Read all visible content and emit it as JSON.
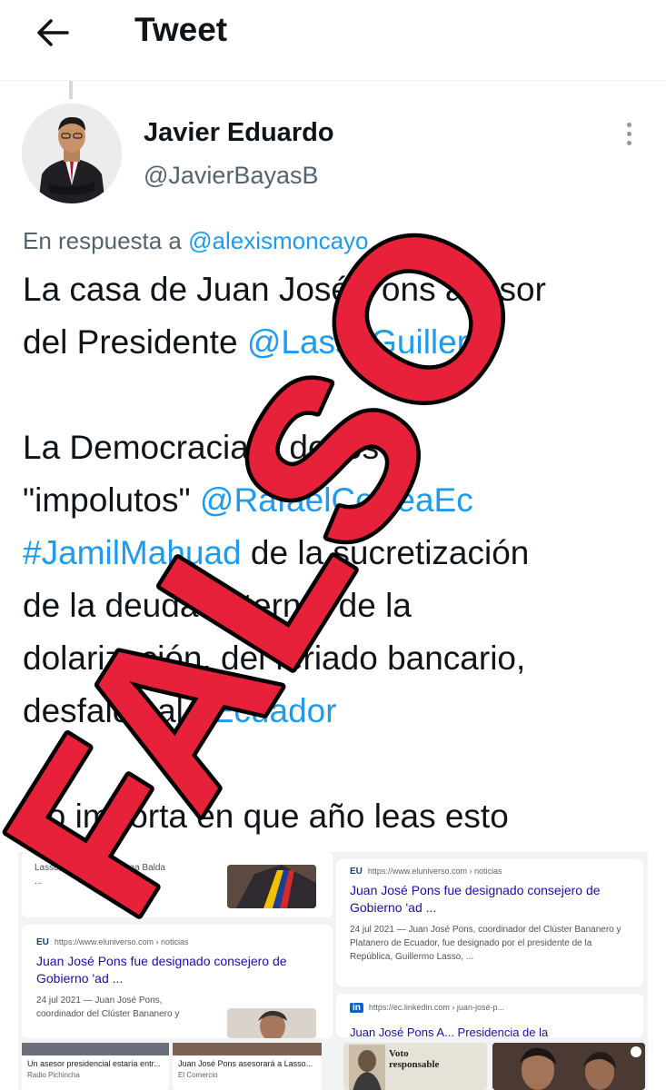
{
  "header": {
    "title": "Tweet",
    "back_icon": "arrow-left-icon"
  },
  "author": {
    "name": "Javier Eduardo",
    "handle": "@JavierBayasB"
  },
  "reply": {
    "prefix": "En respuesta a",
    "mention": "@alexismoncayo"
  },
  "tweet": {
    "line1": "La casa de Juan José Pons asesor",
    "line2_text": "del Presidente ",
    "line2_mention": "@LassoGuiller",
    "line3": "La Democracia P  de los",
    "line4_text": "\"impolutos\" ",
    "line4_mention": "@RafaelCorreaEc",
    "line5_tag": "#JamilMahuad",
    "line5_text": " de la sucretización",
    "line6": "de la deuda externa, de la",
    "line7": "dolarización, del feriado bancario,",
    "line8_text": "desfalco al ",
    "line8_tag": "#Ecuador",
    "line9": "No importa en que año leas esto"
  },
  "stamp": {
    "text": "FALSO",
    "color": "#e8213a"
  },
  "media": {
    "result_top_left": {
      "snippet": "Lasso, Juan Pablo Correa Balda ..."
    },
    "result_left": {
      "source": "EU",
      "url": "https://www.eluniverso.com › noticias",
      "title": "Juan José Pons fue designado consejero de Gobierno 'ad ...",
      "snippet": "24 jul 2021 — Juan José Pons, coordinador del Clúster Bananero y"
    },
    "result_right": {
      "source": "EU",
      "url": "https://www.eluniverso.com › noticias",
      "title": "Juan José Pons fue designado consejero de Gobierno 'ad ...",
      "snippet": "24 jul 2021 — Juan José Pons, coordinador del Clúster Bananero y Platanero de Ecuador, fue designado por el presidente de la República, Guillermo Lasso, ..."
    },
    "result_linkedin": {
      "source": "in",
      "url": "https://ec.linkedin.com › juan-josé-p...",
      "title": "Juan José Pons A... Presidencia de la"
    },
    "bottom_cards": [
      {
        "title": "Un asesor presidencial estaría entr...",
        "source": "Radio Pichincha"
      },
      {
        "title": "Juan José Pons asesorará a Lasso...",
        "source": "El Comercio"
      }
    ],
    "newspaper": {
      "line1": "Voto",
      "line2": "responsable"
    }
  }
}
